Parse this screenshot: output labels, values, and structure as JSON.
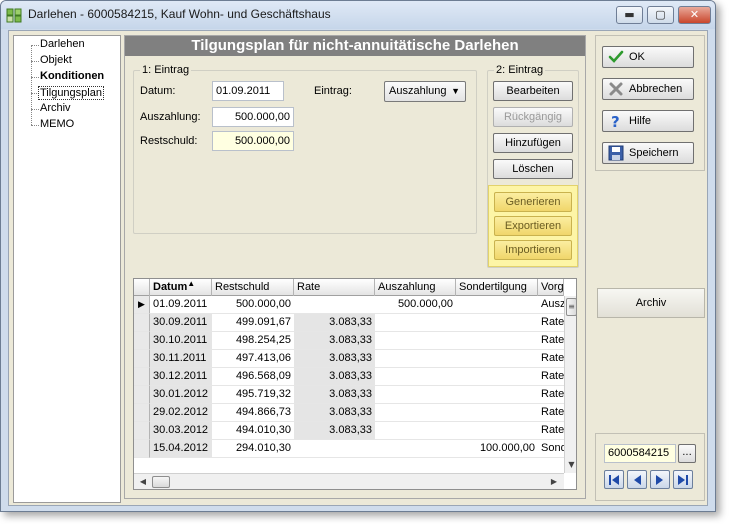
{
  "window": {
    "title": "Darlehen - 6000584215, Kauf Wohn- und Geschäftshaus",
    "minimize": "▬",
    "maximize": "▢",
    "close": "✕"
  },
  "tree": {
    "items": [
      {
        "label": "Darlehen"
      },
      {
        "label": "Objekt"
      },
      {
        "label": "Konditionen"
      },
      {
        "label": "Tilgungsplan"
      },
      {
        "label": "Archiv"
      },
      {
        "label": "MEMO"
      }
    ]
  },
  "panel": {
    "title": "Tilgungsplan für nicht-annuitätische Darlehen"
  },
  "entry1": {
    "group_label": "1: Eintrag",
    "datum_label": "Datum:",
    "datum_value": "01.09.2011",
    "auszahlung_label": "Auszahlung:",
    "auszahlung_value": "500.000,00",
    "restschuld_label": "Restschuld:",
    "restschuld_value": "500.000,00",
    "eintrag_label": "Eintrag:",
    "eintrag_value": "Auszahlung"
  },
  "entry2": {
    "group_label": "2: Eintrag",
    "bearbeiten": "Bearbeiten",
    "rueckgaengig": "Rückgängig",
    "hinzufuegen": "Hinzufügen",
    "loeschen": "Löschen",
    "generieren": "Generieren",
    "exportieren": "Exportieren",
    "importieren": "Importieren"
  },
  "grid": {
    "columns": [
      "Datum",
      "Restschuld",
      "Rate",
      "Auszahlung",
      "Sondertilgung",
      "Vorga"
    ],
    "sort_indicator": "▲",
    "current_row_marker": "▶",
    "rows": [
      {
        "datum": "01.09.2011",
        "restschuld": "500.000,00",
        "rate": "",
        "auszahlung": "500.000,00",
        "sondertilgung": "",
        "vorgang": "Ausza"
      },
      {
        "datum": "30.09.2011",
        "restschuld": "499.091,67",
        "rate": "3.083,33",
        "auszahlung": "",
        "sondertilgung": "",
        "vorgang": "Rate"
      },
      {
        "datum": "30.10.2011",
        "restschuld": "498.254,25",
        "rate": "3.083,33",
        "auszahlung": "",
        "sondertilgung": "",
        "vorgang": "Rate"
      },
      {
        "datum": "30.11.2011",
        "restschuld": "497.413,06",
        "rate": "3.083,33",
        "auszahlung": "",
        "sondertilgung": "",
        "vorgang": "Rate"
      },
      {
        "datum": "30.12.2011",
        "restschuld": "496.568,09",
        "rate": "3.083,33",
        "auszahlung": "",
        "sondertilgung": "",
        "vorgang": "Rate"
      },
      {
        "datum": "30.01.2012",
        "restschuld": "495.719,32",
        "rate": "3.083,33",
        "auszahlung": "",
        "sondertilgung": "",
        "vorgang": "Rate"
      },
      {
        "datum": "29.02.2012",
        "restschuld": "494.866,73",
        "rate": "3.083,33",
        "auszahlung": "",
        "sondertilgung": "",
        "vorgang": "Rate"
      },
      {
        "datum": "30.03.2012",
        "restschuld": "494.010,30",
        "rate": "3.083,33",
        "auszahlung": "",
        "sondertilgung": "",
        "vorgang": "Rate"
      },
      {
        "datum": "15.04.2012",
        "restschuld": "294.010,30",
        "rate": "",
        "auszahlung": "",
        "sondertilgung": "100.000,00",
        "vorgang": "Sond"
      }
    ]
  },
  "actions": {
    "ok": "OK",
    "abbrechen": "Abbrechen",
    "hilfe": "Hilfe",
    "speichern": "Speichern",
    "archiv": "Archiv"
  },
  "navigator": {
    "record": "6000584215",
    "dots": "..."
  }
}
